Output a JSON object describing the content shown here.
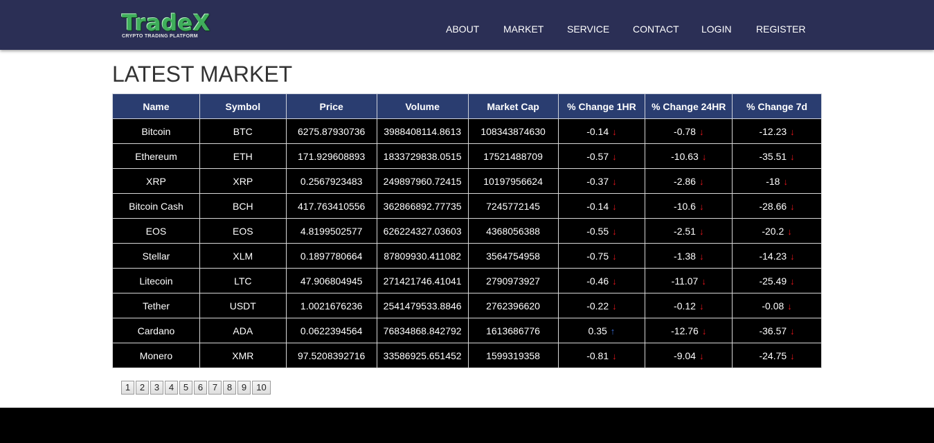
{
  "brand": {
    "name": "TradeX",
    "tagline": "CRYPTO TRADING PLATFORM",
    "colors": {
      "header_bg": "#2b2f55",
      "logo_green": "#3fae5b",
      "table_header_bg": "#2a3d70",
      "down": "#e8151b",
      "up": "#3b6fd8"
    }
  },
  "nav": {
    "items": [
      {
        "label": "ABOUT"
      },
      {
        "label": "MARKET"
      },
      {
        "label": "SERVICE"
      },
      {
        "label": "CONTACT"
      },
      {
        "label": "LOGIN"
      },
      {
        "label": "REGISTER"
      }
    ]
  },
  "main": {
    "title": "LATEST MARKET",
    "table": {
      "columns": [
        "Name",
        "Symbol",
        "Price",
        "Volume",
        "Market Cap",
        "% Change 1HR",
        "% Change 24HR",
        "% Change 7d"
      ],
      "rows": [
        {
          "name": "Bitcoin",
          "symbol": "BTC",
          "price": "6275.87930736",
          "volume": "3988408114.8613",
          "market_cap": "108343874630",
          "change_1h": "-0.14",
          "change_1h_dir": "down-arrow-icon",
          "change_24h": "-0.78",
          "change_24h_dir": "down-arrow-icon",
          "change_7d": "-12.23",
          "change_7d_dir": "down-arrow-icon"
        },
        {
          "name": "Ethereum",
          "symbol": "ETH",
          "price": "171.929608893",
          "volume": "1833729838.0515",
          "market_cap": "17521488709",
          "change_1h": "-0.57",
          "change_1h_dir": "down-arrow-icon",
          "change_24h": "-10.63",
          "change_24h_dir": "down-arrow-icon",
          "change_7d": "-35.51",
          "change_7d_dir": "down-arrow-icon"
        },
        {
          "name": "XRP",
          "symbol": "XRP",
          "price": "0.2567923483",
          "volume": "249897960.72415",
          "market_cap": "10197956624",
          "change_1h": "-0.37",
          "change_1h_dir": "down-arrow-icon",
          "change_24h": "-2.86",
          "change_24h_dir": "down-arrow-icon",
          "change_7d": "-18",
          "change_7d_dir": "down-arrow-icon"
        },
        {
          "name": "Bitcoin Cash",
          "symbol": "BCH",
          "price": "417.763410556",
          "volume": "362866892.77735",
          "market_cap": "7245772145",
          "change_1h": "-0.14",
          "change_1h_dir": "down-arrow-icon",
          "change_24h": "-10.6",
          "change_24h_dir": "down-arrow-icon",
          "change_7d": "-28.66",
          "change_7d_dir": "down-arrow-icon"
        },
        {
          "name": "EOS",
          "symbol": "EOS",
          "price": "4.8199502577",
          "volume": "626224327.03603",
          "market_cap": "4368056388",
          "change_1h": "-0.55",
          "change_1h_dir": "down-arrow-icon",
          "change_24h": "-2.51",
          "change_24h_dir": "down-arrow-icon",
          "change_7d": "-20.2",
          "change_7d_dir": "down-arrow-icon"
        },
        {
          "name": "Stellar",
          "symbol": "XLM",
          "price": "0.1897780664",
          "volume": "87809930.411082",
          "market_cap": "3564754958",
          "change_1h": "-0.75",
          "change_1h_dir": "down-arrow-icon",
          "change_24h": "-1.38",
          "change_24h_dir": "down-arrow-icon",
          "change_7d": "-14.23",
          "change_7d_dir": "down-arrow-icon"
        },
        {
          "name": "Litecoin",
          "symbol": "LTC",
          "price": "47.906804945",
          "volume": "271421746.41041",
          "market_cap": "2790973927",
          "change_1h": "-0.46",
          "change_1h_dir": "down-arrow-icon",
          "change_24h": "-11.07",
          "change_24h_dir": "down-arrow-icon",
          "change_7d": "-25.49",
          "change_7d_dir": "down-arrow-icon"
        },
        {
          "name": "Tether",
          "symbol": "USDT",
          "price": "1.0021676236",
          "volume": "2541479533.8846",
          "market_cap": "2762396620",
          "change_1h": "-0.22",
          "change_1h_dir": "down-arrow-icon",
          "change_24h": "-0.12",
          "change_24h_dir": "down-arrow-icon",
          "change_7d": "-0.08",
          "change_7d_dir": "down-arrow-icon"
        },
        {
          "name": "Cardano",
          "symbol": "ADA",
          "price": "0.0622394564",
          "volume": "76834868.842792",
          "market_cap": "1613686776",
          "change_1h": "0.35",
          "change_1h_dir": "up-arrow-icon",
          "change_24h": "-12.76",
          "change_24h_dir": "down-arrow-icon",
          "change_7d": "-36.57",
          "change_7d_dir": "down-arrow-icon"
        },
        {
          "name": "Monero",
          "symbol": "XMR",
          "price": "97.5208392716",
          "volume": "33586925.651452",
          "market_cap": "1599319358",
          "change_1h": "-0.81",
          "change_1h_dir": "down-arrow-icon",
          "change_24h": "-9.04",
          "change_24h_dir": "down-arrow-icon",
          "change_7d": "-24.75",
          "change_7d_dir": "down-arrow-icon"
        }
      ]
    },
    "pagination": {
      "pages": [
        "1",
        "2",
        "3",
        "4",
        "5",
        "6",
        "7",
        "8",
        "9",
        "10"
      ]
    }
  }
}
